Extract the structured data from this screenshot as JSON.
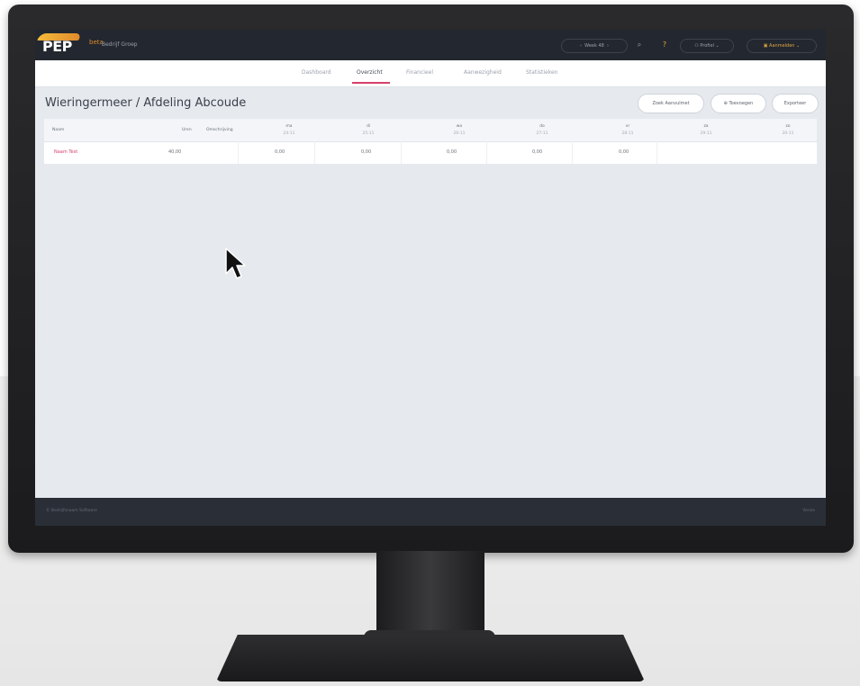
{
  "app": {
    "logo": "PEP",
    "logo_sub": "beta",
    "org": "Bedrijf Groep"
  },
  "topbar": {
    "period": "Week 48",
    "help_badge": "?",
    "user": "Profiel",
    "account": "Aanmelden"
  },
  "tabs": [
    {
      "label": "Dashboard",
      "active": false
    },
    {
      "label": "Overzicht",
      "active": true
    },
    {
      "label": "Financieel",
      "active": false
    },
    {
      "label": "Aanwezigheid",
      "active": false
    },
    {
      "label": "Statistieken",
      "active": false
    }
  ],
  "page": {
    "title": "Wieringermeer / Afdeling Abcoude",
    "buttons": [
      "Zoek Aanvulmet",
      "Toevoegen",
      "Exporteer"
    ]
  },
  "table": {
    "headers": [
      "Naam",
      "Uren",
      "Omschrijving"
    ],
    "days": [
      {
        "day": "ma",
        "date": "24-11"
      },
      {
        "day": "di",
        "date": "25-11"
      },
      {
        "day": "wo",
        "date": "26-11"
      },
      {
        "day": "do",
        "date": "27-11"
      },
      {
        "day": "vr",
        "date": "28-11"
      },
      {
        "day": "za",
        "date": "29-11"
      },
      {
        "day": "zo",
        "date": "30-11"
      }
    ],
    "rows": [
      {
        "name": "Naam Test",
        "hours": "40,00",
        "values": [
          "0,00",
          "0,00",
          "0,00",
          "0,00",
          "0,00",
          "",
          ""
        ]
      }
    ]
  },
  "footer": {
    "left": "© Bedrijfsnaam Software",
    "right": "Versie"
  },
  "colors": {
    "accent": "#d6406b",
    "topbar": "#23272f",
    "brand": "#e08a2c"
  }
}
